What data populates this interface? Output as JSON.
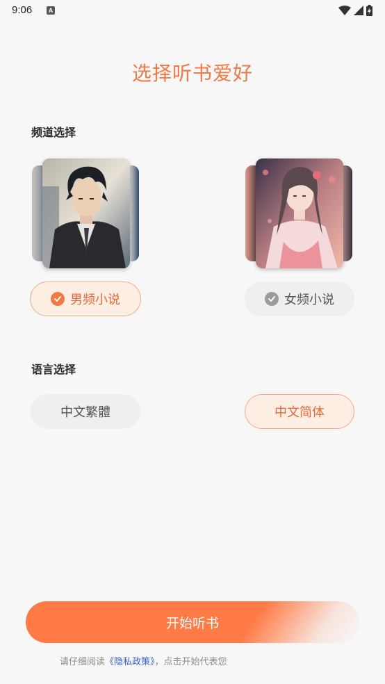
{
  "status_bar": {
    "time": "9:06",
    "notification_glyph": "A"
  },
  "title": "选择听书爱好",
  "channel": {
    "label": "频道选择",
    "options": [
      {
        "label": "男频小说",
        "selected": true,
        "image_icon": "male-character-illustration"
      },
      {
        "label": "女频小说",
        "selected": false,
        "image_icon": "female-character-illustration"
      }
    ]
  },
  "language": {
    "label": "语言选择",
    "options": [
      {
        "label": "中文繁體",
        "selected": false
      },
      {
        "label": "中文简体",
        "selected": true
      }
    ]
  },
  "start_button": {
    "label": "开始听书"
  },
  "privacy": {
    "prefix": "请仔细阅读",
    "link": "《隐私政策》",
    "suffix": "，点击开始代表您"
  },
  "colors": {
    "accent": "#ff7a45",
    "title": "#f07a45",
    "selected_bg": "#fdeee4",
    "link": "#3a63c4"
  }
}
